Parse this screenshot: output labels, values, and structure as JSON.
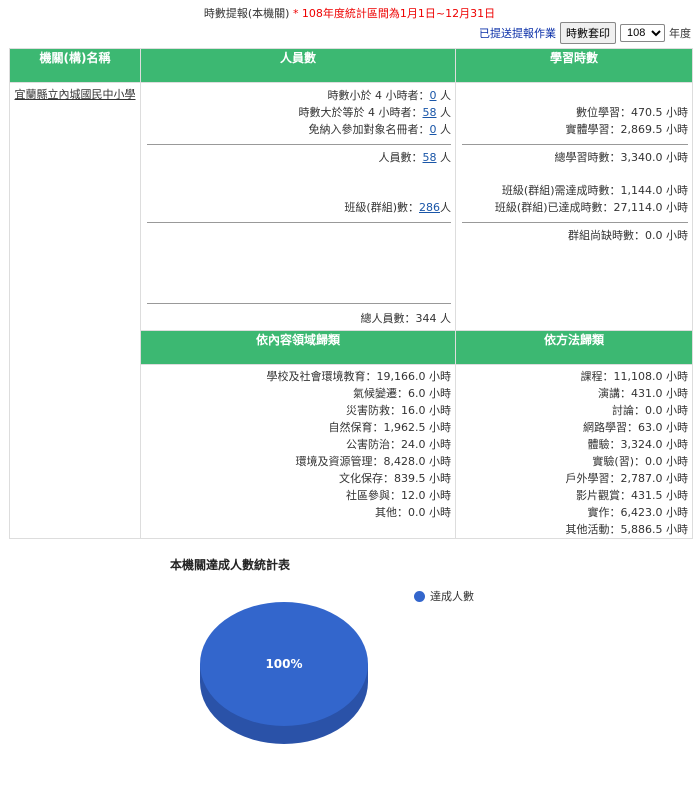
{
  "header": {
    "title": "時數提報(本機關)",
    "period": "* 108年度統計區間為1月1日~12月31日",
    "submitted_link": "已提送提報作業",
    "print_button": "時數套印",
    "year_select": "108",
    "year_suffix": "年度"
  },
  "table": {
    "headers": {
      "agency": "機關(構)名稱",
      "personnel": "人員數",
      "hours": "學習時數"
    },
    "agency_name": "宜蘭縣立內城國民中小學",
    "personnel": {
      "less4_label": "時數小於 4 小時者：",
      "less4_value": "0",
      "less4_unit": " 人",
      "ge4_label": "時數大於等於 4 小時者：",
      "ge4_value": "58",
      "ge4_unit": " 人",
      "exempt_label": "免納入參加對象名冊者：",
      "exempt_value": "0",
      "exempt_unit": " 人",
      "count_label": "人員數：",
      "count_value": "58",
      "count_unit": " 人",
      "class_label": "班級(群組)數：",
      "class_value": "286",
      "class_unit": "人",
      "total_label": "總人員數：",
      "total_value": "344",
      "total_unit": " 人"
    },
    "hours": {
      "digital": "數位學習：470.5 小時",
      "physical": "實體學習：2,869.5 小時",
      "total": "總學習時數：3,340.0 小時",
      "class_need": "班級(群組)需達成時數：1,144.0 小時",
      "class_done": "班級(群組)已達成時數：27,114.0 小時",
      "group_missing": "群組尚缺時數：0.0 小時"
    },
    "domain_header": "依內容領域歸類",
    "method_header": "依方法歸類",
    "domain_items": [
      "學校及社會環境教育：19,166.0 小時",
      "氣候變遷：6.0 小時",
      "災害防救：16.0 小時",
      "自然保育：1,962.5 小時",
      "公害防治：24.0 小時",
      "環境及資源管理：8,428.0 小時",
      "文化保存：839.5 小時",
      "社區參與：12.0 小時",
      "其他：0.0 小時"
    ],
    "method_items": [
      "課程：11,108.0 小時",
      "演講：431.0 小時",
      "討論：0.0 小時",
      "網路學習：63.0 小時",
      "體驗：3,324.0 小時",
      "實驗(習)：0.0 小時",
      "戶外學習：2,787.0 小時",
      "影片觀賞：431.5 小時",
      "實作：6,423.0 小時",
      "其他活動：5,886.5 小時"
    ]
  },
  "chart_data": {
    "type": "pie",
    "title": "本機關達成人數統計表",
    "categories": [
      "達成人數"
    ],
    "values": [
      100
    ],
    "labels": [
      "100%"
    ],
    "colors": [
      "#3366cc"
    ]
  }
}
